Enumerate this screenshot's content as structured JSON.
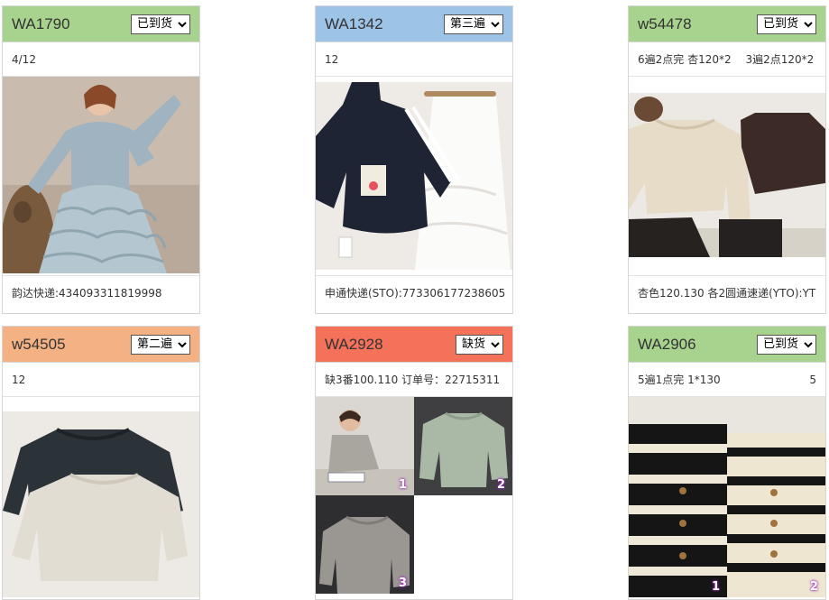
{
  "status_options": [
    "已到货",
    "第二遍",
    "第三遍",
    "缺货"
  ],
  "cards": [
    {
      "id": "WA1790",
      "header_color": "#a8d38e",
      "status": "已到货",
      "note": "4/12",
      "note_right": "",
      "tracking": "韵达快递:434093311819998",
      "photos": [
        {
          "description": "girl-in-light-blue-ruffled-dress-icon",
          "index_label": ""
        }
      ]
    },
    {
      "id": "WA1342",
      "header_color": "#9dc3e6",
      "status": "第三遍",
      "note": "12",
      "note_right": "",
      "tracking": "申通快递(STO):773306177238605",
      "photos": [
        {
          "description": "navy-jacket-and-white-skirt-icon",
          "index_label": ""
        }
      ]
    },
    {
      "id": "w54478",
      "header_color": "#a8d38e",
      "status": "已到货",
      "note": "6遍2点完 杏120*2　 3遍2点120*2",
      "note_right": "",
      "tracking": "杏色120.130 各2圆通速递(YTO):YT",
      "photos": [
        {
          "description": "cream-and-brown-sweaters-icon",
          "index_label": ""
        }
      ]
    },
    {
      "id": "w54505",
      "header_color": "#f4b183",
      "status": "第二遍",
      "note": "12",
      "note_right": "",
      "tracking": "",
      "photos": [
        {
          "description": "dark-and-oatmeal-knit-sweaters-icon",
          "index_label": ""
        }
      ]
    },
    {
      "id": "WA2928",
      "header_color": "#f4715a",
      "status": "缺货",
      "note": "缺3番100.110  订单号：22715311",
      "note_right": "",
      "tracking": "",
      "photos": [
        {
          "description": "child-wearing-grey-sweater-icon",
          "index_label": "1"
        },
        {
          "description": "sage-green-sweater-flatlay-icon",
          "index_label": "2"
        },
        {
          "description": "grey-knit-sweater-closeup-icon",
          "index_label": "3"
        }
      ]
    },
    {
      "id": "WA2906",
      "header_color": "#a8d38e",
      "status": "已到货",
      "note": "5遍1点完 1*130",
      "note_right": "5",
      "tracking": "",
      "photos": [
        {
          "description": "black-striped-cardigan-icon",
          "index_label": "1"
        },
        {
          "description": "cream-striped-cardigan-icon",
          "index_label": "2"
        }
      ]
    }
  ]
}
